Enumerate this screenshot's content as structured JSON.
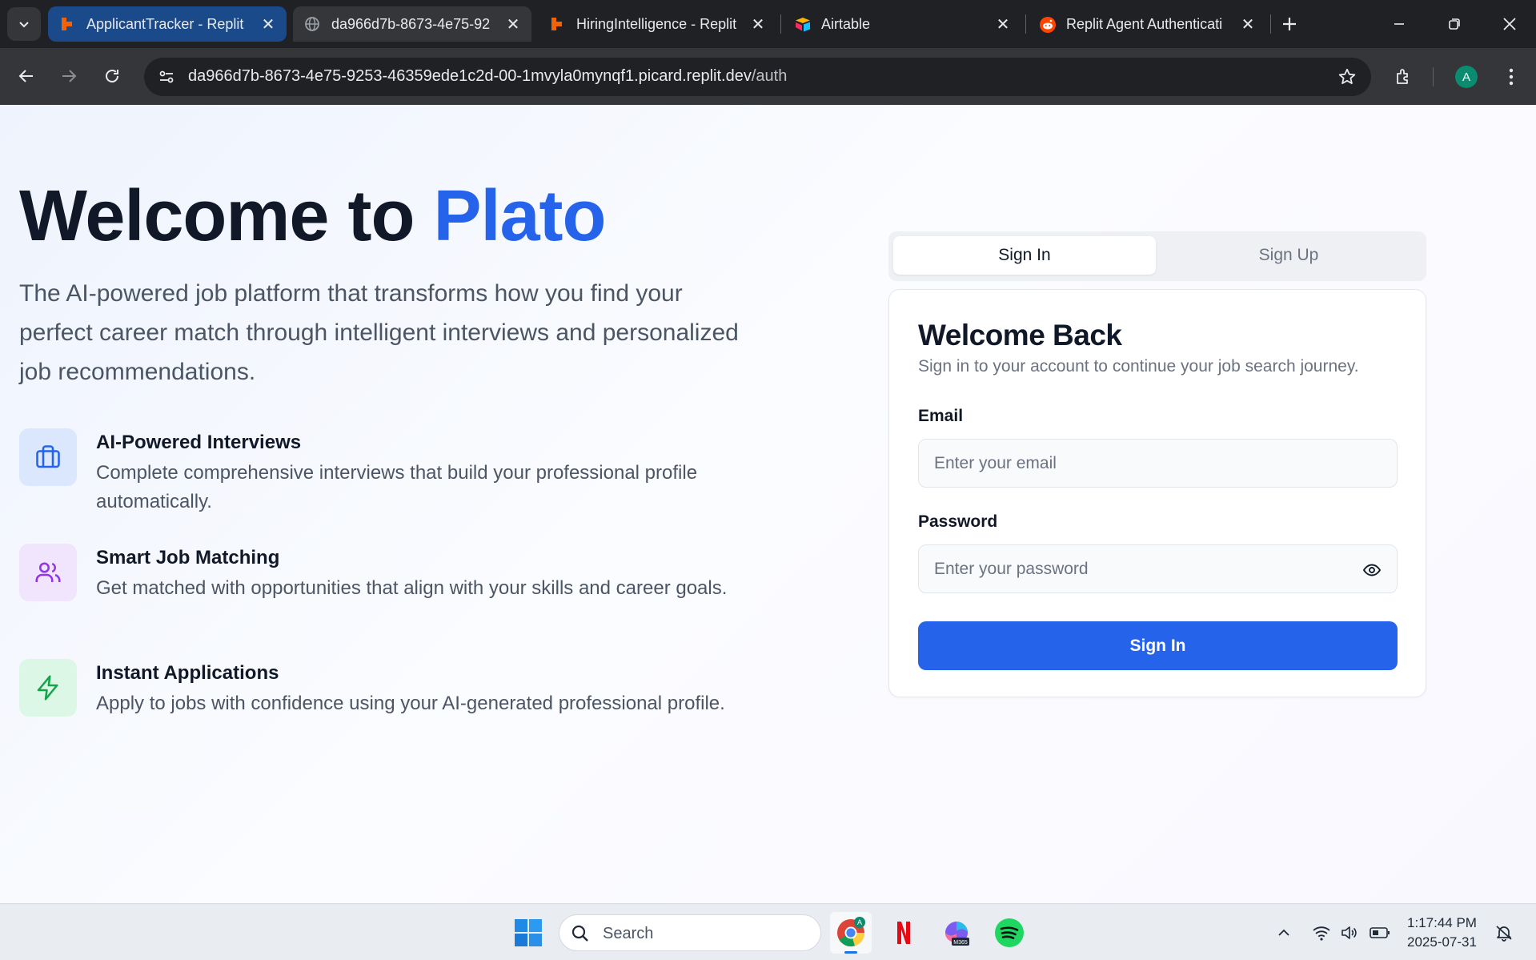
{
  "browser": {
    "tabs": [
      {
        "title": "ApplicantTracker - Replit",
        "favicon": "replit-icon"
      },
      {
        "title": "da966d7b-8673-4e75-92",
        "favicon": "globe-icon"
      },
      {
        "title": "HiringIntelligence - Replit",
        "favicon": "replit-icon"
      },
      {
        "title": "Airtable",
        "favicon": "airtable-icon"
      },
      {
        "title": "Replit Agent Authenticati",
        "favicon": "reddit-icon"
      }
    ],
    "url_main": "da966d7b-8673-4e75-9253-46359ede1c2d-00-1mvyla0mynqf1.picard.replit.dev",
    "url_path": "/auth",
    "profile_initial": "A"
  },
  "hero": {
    "title_prefix": "Welcome to ",
    "title_accent": "Plato",
    "subtitle": "The AI-powered job platform that transforms how you find your perfect career match through intelligent interviews and personalized job recommendations."
  },
  "features": [
    {
      "title": "AI-Powered Interviews",
      "description": "Complete comprehensive interviews that build your professional profile automatically.",
      "icon": "briefcase-icon",
      "color": "#2563eb",
      "bg": "#dbe7fd"
    },
    {
      "title": "Smart Job Matching",
      "description": "Get matched with opportunities that align with your skills and career goals.",
      "icon": "users-icon",
      "color": "#9333ea",
      "bg": "#f1e4fd"
    },
    {
      "title": "Instant Applications",
      "description": "Apply to jobs with confidence using your AI-generated professional profile.",
      "icon": "zap-icon",
      "color": "#16a34a",
      "bg": "#dcf7e6"
    }
  ],
  "auth": {
    "tab_signin": "Sign In",
    "tab_signup": "Sign Up",
    "card_title": "Welcome Back",
    "card_subtitle": "Sign in to your account to continue your job search journey.",
    "email_label": "Email",
    "email_placeholder": "Enter your email",
    "password_label": "Password",
    "password_placeholder": "Enter your password",
    "submit_label": "Sign In"
  },
  "taskbar": {
    "search_placeholder": "Search",
    "time": "1:17:44 PM",
    "date": "2025-07-31",
    "apps": [
      "windows-start-icon",
      "chrome-icon",
      "netflix-icon",
      "m365-copilot-icon",
      "spotify-icon"
    ]
  }
}
